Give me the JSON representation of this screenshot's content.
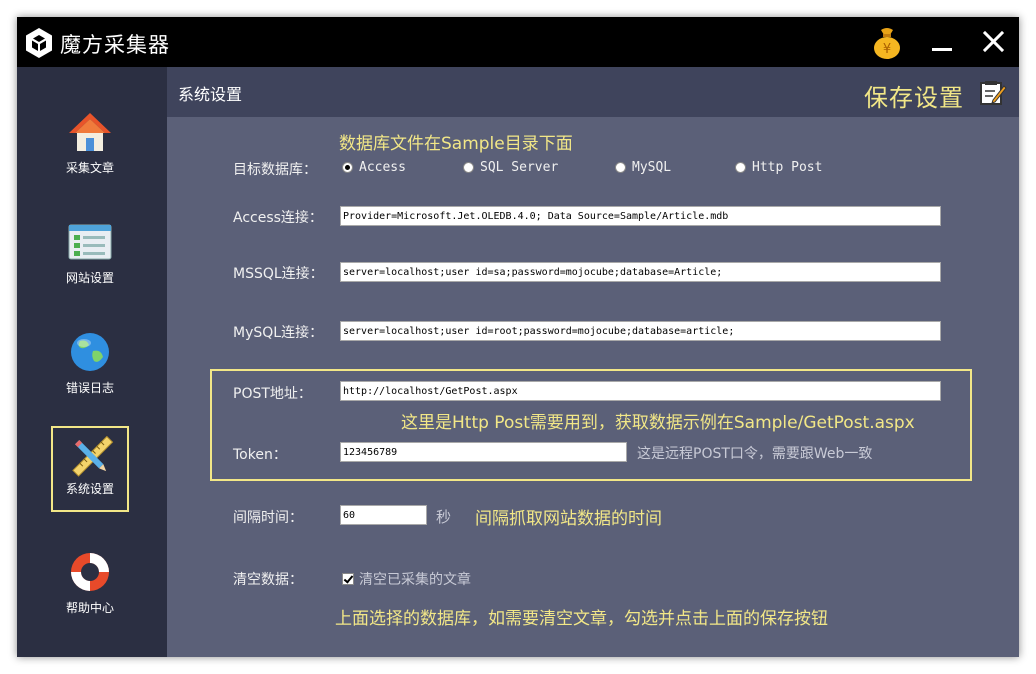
{
  "app": {
    "title": "魔方采集器"
  },
  "sidebar": {
    "items": [
      {
        "label": "采集文章",
        "icon": "home-icon",
        "active": false
      },
      {
        "label": "网站设置",
        "icon": "settings-list-icon",
        "active": false
      },
      {
        "label": "错误日志",
        "icon": "globe-icon",
        "active": false
      },
      {
        "label": "系统设置",
        "icon": "pencil-ruler-icon",
        "active": true
      },
      {
        "label": "帮助中心",
        "icon": "lifebuoy-icon",
        "active": false
      }
    ]
  },
  "header": {
    "title": "系统设置",
    "save_label": "保存设置"
  },
  "form": {
    "db_note": "数据库文件在Sample目录下面",
    "db_label": "目标数据库：",
    "db_options": [
      "Access",
      "SQL Server",
      "MySQL",
      "Http Post"
    ],
    "db_selected": "Access",
    "access_label": "Access连接：",
    "access_value": "Provider=Microsoft.Jet.OLEDB.4.0; Data Source=Sample/Article.mdb",
    "mssql_label": "MSSQL连接：",
    "mssql_value": "server=localhost;user id=sa;password=mojocube;database=Article;",
    "mysql_label": "MySQL连接：",
    "mysql_value": "server=localhost;user id=root;password=mojocube;database=article;",
    "post_label": "POST地址：",
    "post_value": "http://localhost/GetPost.aspx",
    "post_note": "这里是Http Post需要用到，获取数据示例在Sample/GetPost.aspx",
    "token_label": "Token：",
    "token_value": "123456789",
    "token_hint": "这是远程POST口令，需要跟Web一致",
    "interval_label": "间隔时间：",
    "interval_value": "60",
    "interval_unit": "秒",
    "interval_note": "间隔抓取网站数据的时间",
    "clear_label": "清空数据：",
    "clear_checkbox_label": "清空已采集的文章",
    "clear_checked": true,
    "clear_note": "上面选择的数据库，如需要清空文章，勾选并点击上面的保存按钮"
  },
  "colors": {
    "accent": "#f2e787",
    "sidebar_bg": "#2b2f42",
    "header_bg": "#3f445c",
    "content_bg": "#5b6078",
    "titlebar_bg": "#000000"
  }
}
